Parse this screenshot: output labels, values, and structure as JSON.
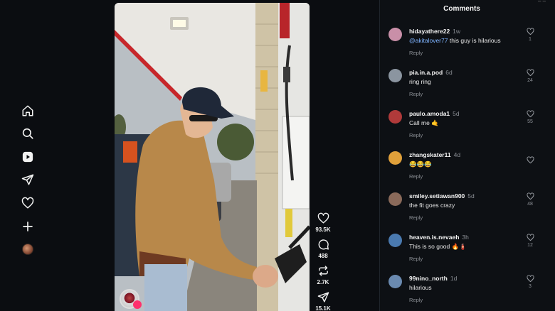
{
  "nav": {
    "items": [
      {
        "name": "home"
      },
      {
        "name": "search"
      },
      {
        "name": "reels"
      },
      {
        "name": "messages"
      },
      {
        "name": "notifications"
      },
      {
        "name": "create"
      },
      {
        "name": "profile"
      }
    ]
  },
  "actions": {
    "likes": "93.5K",
    "comments": "488",
    "reposts": "2.7K",
    "shares": "15.1K"
  },
  "comments_panel": {
    "title": "Comments",
    "reply_label": "Reply",
    "items": [
      {
        "user": "hidayathere22",
        "time": "1w",
        "mention": "@akitalover77",
        "text": " this guy is hilarious",
        "likes": "1",
        "avatar_color": "#c98fa8"
      },
      {
        "user": "pia.in.a.pod",
        "time": "6d",
        "mention": "",
        "text": "ring ring",
        "likes": "24",
        "avatar_color": "#8b95a0"
      },
      {
        "user": "paulo.amoda1",
        "time": "5d",
        "mention": "",
        "text": "Call me 🤙",
        "likes": "55",
        "avatar_color": "#b03a3a"
      },
      {
        "user": "zhangskater11",
        "time": "4d",
        "mention": "",
        "text": "😂😂😂",
        "likes": "",
        "avatar_color": "#e0a03a"
      },
      {
        "user": "smiley.setiawan900",
        "time": "5d",
        "mention": "",
        "text": "the fit goes crazy",
        "likes": "48",
        "avatar_color": "#8a6a5a"
      },
      {
        "user": "heaven.is.nevaeh",
        "time": "3h",
        "mention": "",
        "text": "This is so good 🔥🧯",
        "likes": "12",
        "avatar_color": "#4a7ab0"
      },
      {
        "user": "99nino_north",
        "time": "1d",
        "mention": "",
        "text": "hilarious",
        "likes": "3",
        "avatar_color": "#6a8ab0"
      }
    ]
  },
  "colors": {
    "background": "#0b0d11",
    "panel": "#0d1014",
    "mention": "#7fb4ff",
    "muted": "#8b8f95"
  }
}
